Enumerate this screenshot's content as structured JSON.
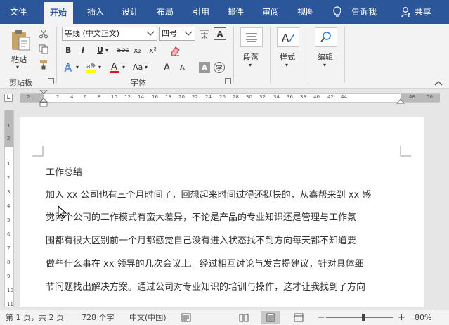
{
  "tabs": [
    "文件",
    "开始",
    "插入",
    "设计",
    "布局",
    "引用",
    "邮件",
    "审阅",
    "视图"
  ],
  "tell_me": "告诉我",
  "share": "共享",
  "clipboard": {
    "paste": "粘贴",
    "group": "剪贴板"
  },
  "font": {
    "name": "等线 (中文正文)",
    "size": "四号",
    "group": "字体",
    "bold": "B",
    "italic": "I",
    "underline": "U",
    "strike": "abc",
    "sub": "x₂",
    "sup": "x²",
    "case": "Aa",
    "grow": "A",
    "shrink": "A"
  },
  "paragraph": {
    "label": "段落"
  },
  "styles": {
    "label": "样式"
  },
  "editing": {
    "label": "编辑"
  },
  "ruler": {
    "ticks": [
      "2",
      "2",
      "4",
      "6",
      "8",
      "10",
      "12",
      "14",
      "16",
      "18",
      "20",
      "22",
      "24",
      "26",
      "28",
      "30",
      "32",
      "34",
      "36",
      "38",
      "40",
      "42",
      "44",
      "48",
      "50"
    ]
  },
  "vruler": {
    "ticks": [
      "1",
      "2",
      "1",
      "2",
      "3",
      "4",
      "5",
      "6",
      "7",
      "8",
      "9",
      "10",
      "11"
    ]
  },
  "doc": {
    "title": "工作总结",
    "lines": [
      "加入 xx 公司也有三个月时间了，回想起来时间过得还挺快的，从鑫帮来到 xx 感",
      "觉两个公司的工作模式有蛮大差异，不论是产品的专业知识还是管理与工作氛",
      "围都有很大区别前一个月都感觉自己没有进入状态找不到方向每天都不知道要",
      "做些什么事在 xx 领导的几次会议上。经过相互讨论与发言提建议，针对具体细",
      "节问题找出解决方案。通过公司对专业知识的培训与操作，这才让我找到了方向"
    ]
  },
  "status": {
    "page": "第 1 页，共 2 页",
    "words": "728 个字",
    "lang": "中文(中国)",
    "zoom": "80%",
    "zoom_level": 0.55
  },
  "colors": {
    "brand": "#2b579a",
    "highlight": "#ffff00",
    "font_color": "#e81123"
  }
}
